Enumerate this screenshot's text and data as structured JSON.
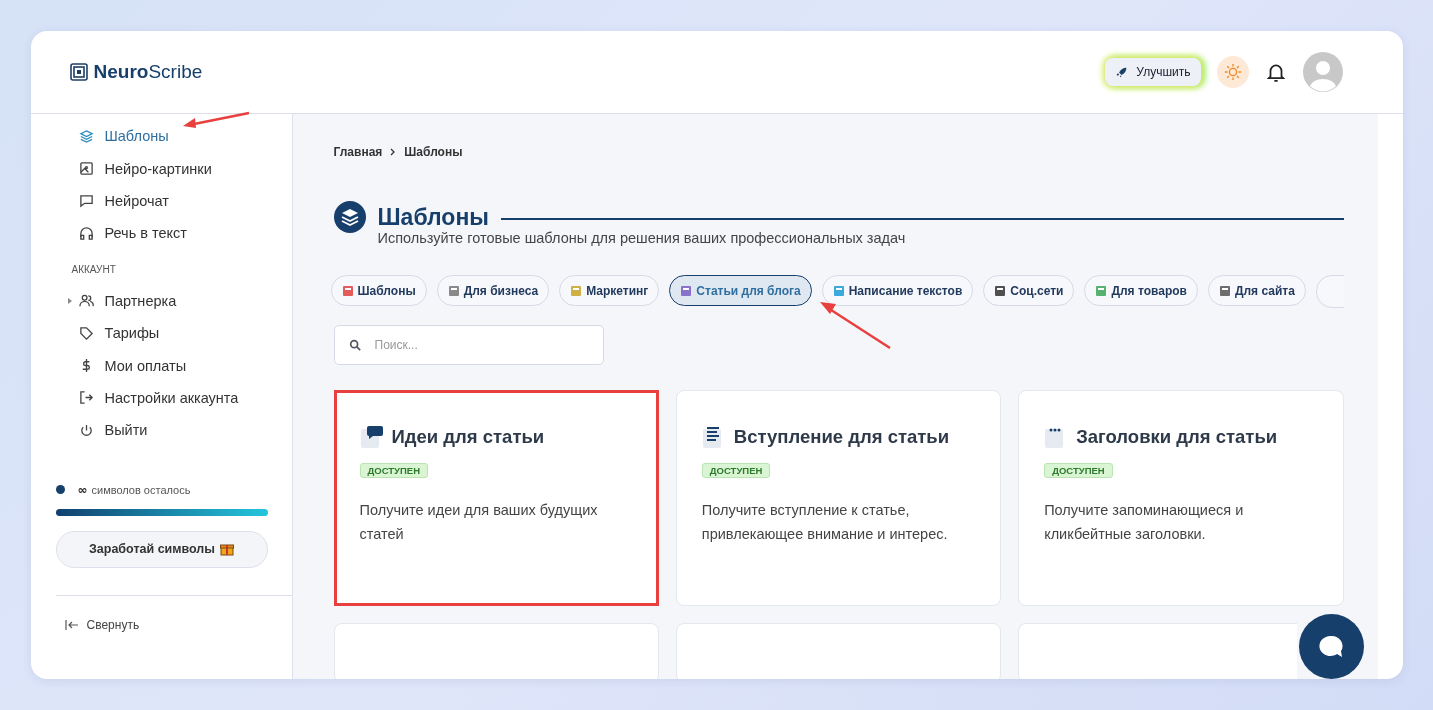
{
  "header": {
    "logo": "**Neuro**Scribe",
    "upgrade_button": "Улучшить"
  },
  "sidebar": {
    "items": [
      {
        "label": "Шаблоны",
        "selected": true
      },
      {
        "label": "Нейро-картинки",
        "selected": false
      },
      {
        "label": "Нейрочат",
        "selected": false
      },
      {
        "label": "Речь в текст",
        "selected": false
      }
    ],
    "section_label": "АККАУНТ",
    "account_items": [
      {
        "label": "Партнерка",
        "expandable": true
      },
      {
        "label": "Тарифы",
        "expandable": false
      },
      {
        "label": "Мои оплаты",
        "expandable": false
      },
      {
        "label": "Настройки аккаунта",
        "expandable": false
      },
      {
        "label": "Выйти",
        "expandable": false
      }
    ],
    "credits": {
      "amount": "∞",
      "label": "символов осталось",
      "level": 1
    },
    "earn_button": "Заработай символы",
    "collapse": "Свернуть"
  },
  "breadcrumb": [
    "Главная",
    "Шаблоны"
  ],
  "page": {
    "title": "Шаблоны",
    "subtitle": "Используйте готовые шаблоны для решения ваших профессиональных задач"
  },
  "categories": [
    {
      "label": "Шаблоны",
      "selected": false
    },
    {
      "label": "Для бизнеса",
      "selected": false
    },
    {
      "label": "Маркетинг",
      "selected": false
    },
    {
      "label": "Статьи для блога",
      "selected": true
    },
    {
      "label": "Написание текстов",
      "selected": false
    },
    {
      "label": "Соц.сети",
      "selected": false
    },
    {
      "label": "Для товаров",
      "selected": false
    },
    {
      "label": "Для сайта",
      "selected": false
    }
  ],
  "search": {
    "placeholder": "Поиск..."
  },
  "cards": [
    {
      "title": "Идеи для статьи",
      "badge": "ДОСТУПЕН",
      "description": "Получите идеи для ваших будущих статей",
      "highlighted": true
    },
    {
      "title": "Вступление для статьи",
      "badge": "ДОСТУПЕН",
      "description": "Получите вступление к статье, привлекающее внимание и интерес.",
      "highlighted": false
    },
    {
      "title": "Заголовки для статьи",
      "badge": "ДОСТУПЕН",
      "description": "Получите запоминающиеся и кликбейтные заголовки.",
      "highlighted": false
    }
  ]
}
